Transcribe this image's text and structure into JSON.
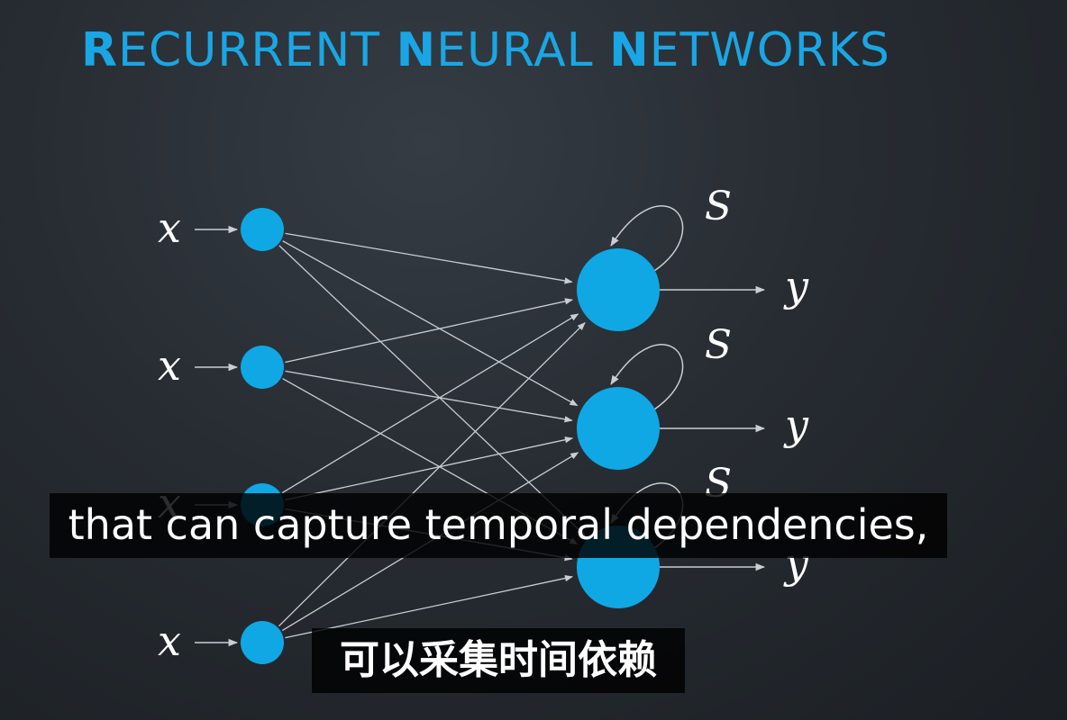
{
  "title": {
    "segments": [
      {
        "text": "R",
        "bold": true
      },
      {
        "text": "ECURRENT ",
        "bold": false
      },
      {
        "text": "N",
        "bold": true
      },
      {
        "text": "EURAL ",
        "bold": false
      },
      {
        "text": "N",
        "bold": true
      },
      {
        "text": "ETWORKS",
        "bold": false
      }
    ]
  },
  "diagram": {
    "input_label": "x",
    "output_label": "y",
    "state_label": "S",
    "input_count": 4,
    "output_count": 3
  },
  "subtitles": {
    "english": "that can capture temporal dependencies,",
    "chinese": "可以采集时间依赖"
  },
  "colors": {
    "title": "#1aa6e4",
    "node": "#0fa8e4",
    "edge": "#c9ced3",
    "label": "#ffffff"
  }
}
